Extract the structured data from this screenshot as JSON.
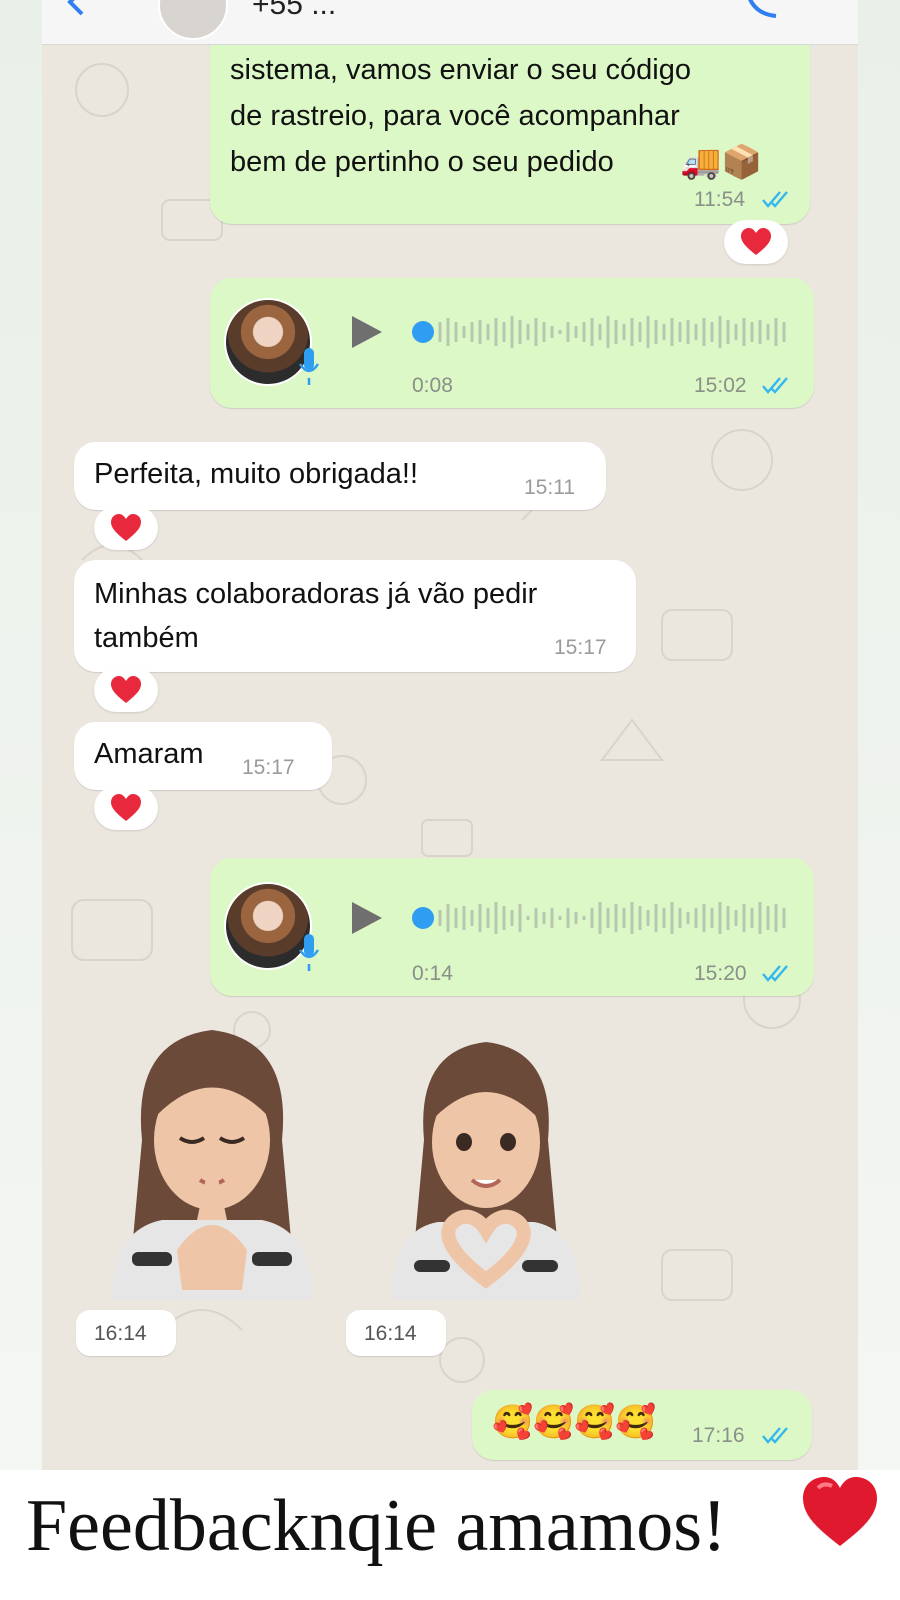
{
  "header": {
    "contact_label": "+55 ..."
  },
  "messages": {
    "m1": {
      "text": "sistema, vamos enviar o seu código de rastreio, para você acompanhar bem de pertinho o seu pedido 🚚📦",
      "line1": "sistema, vamos enviar o seu código",
      "line2": "de rastreio, para você acompanhar",
      "line3": "bem de pertinho o seu pedido",
      "emoji": "🚚📦",
      "time": "11:54"
    },
    "voice1": {
      "duration": "0:08",
      "time": "15:02"
    },
    "m2": {
      "text": "Perfeita, muito obrigada!!",
      "time": "15:11"
    },
    "m3": {
      "line1": "Minhas colaboradoras já vão pedir",
      "line2": "também",
      "time": "15:17"
    },
    "m4": {
      "text": "Amaram",
      "time": "15:17"
    },
    "voice2": {
      "duration": "0:14",
      "time": "15:20"
    },
    "sticker1": {
      "time": "16:14",
      "icon": "memoji-praying-sticker"
    },
    "sticker2": {
      "time": "16:14",
      "icon": "memoji-heart-hands-sticker"
    },
    "m5": {
      "emojis": "🥰🥰🥰🥰",
      "time": "17:16"
    }
  },
  "reaction": {
    "icon": "red-heart"
  },
  "caption": {
    "text": "Feedbacknqie amamos!"
  },
  "colors": {
    "outgoing": "#dcf8c6",
    "incoming": "#ffffff",
    "tick": "#34b7f1",
    "play_dot": "#2f9ef2"
  }
}
